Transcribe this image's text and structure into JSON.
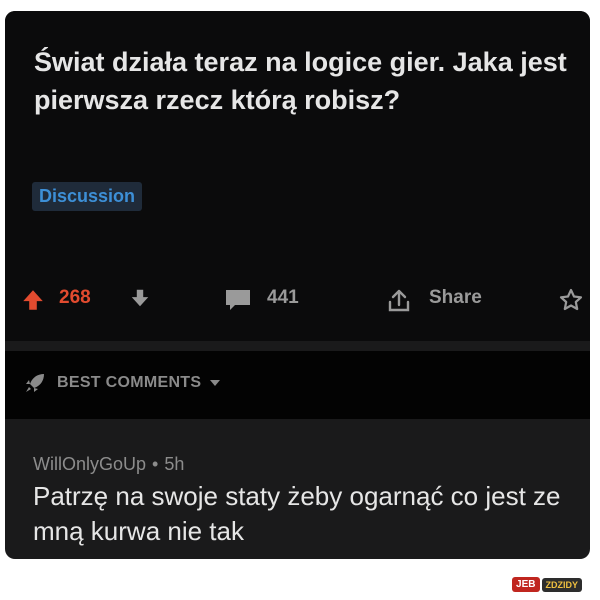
{
  "post": {
    "title": "Świat działa teraz na logice gier. Jaka jest pierwsza rzecz którą robisz?",
    "flair": "Discussion",
    "score": "268",
    "comments_count": "441",
    "share_label": "Share",
    "icons": {
      "upvote": "arrow-up-icon",
      "downvote": "arrow-down-icon",
      "comments": "comment-bubble-icon",
      "share": "share-icon",
      "award": "award-icon"
    },
    "colors": {
      "upvote": "#e24b2f",
      "flair": "#3d8fd6"
    }
  },
  "sort": {
    "label": "BEST COMMENTS",
    "icon": "rocket-icon"
  },
  "comment": {
    "author": "WillOnlyGoUp",
    "separator": "•",
    "time": "5h",
    "body": "Patrzę na swoje staty żeby ogarnąć co jest ze mną kurwa nie tak"
  },
  "watermark": {
    "part1": "JEB",
    "part2": "ZDZIDY"
  }
}
